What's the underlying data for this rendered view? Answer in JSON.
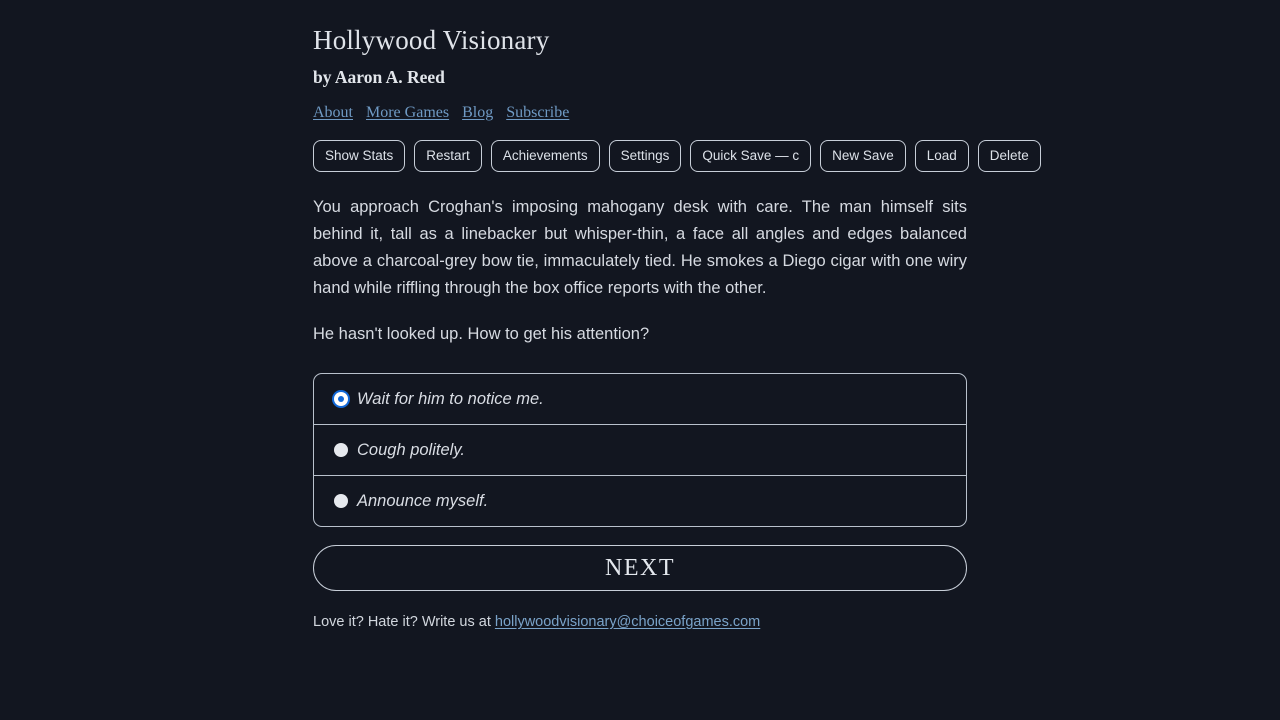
{
  "page": {
    "background_color": "#121620",
    "text_color": "#d6dae1",
    "link_color": "#6f9ac4",
    "accent_color": "#1168d8",
    "border_color": "#c7ced8"
  },
  "header": {
    "title": "Hollywood Visionary",
    "byline": "by Aaron A. Reed",
    "nav": [
      {
        "label": "About"
      },
      {
        "label": "More Games"
      },
      {
        "label": "Blog"
      },
      {
        "label": "Subscribe"
      }
    ]
  },
  "toolbar": {
    "buttons": [
      {
        "label": "Show Stats"
      },
      {
        "label": "Restart"
      },
      {
        "label": "Achievements"
      },
      {
        "label": "Settings"
      },
      {
        "label": "Quick Save — c"
      },
      {
        "label": "New Save"
      },
      {
        "label": "Load"
      },
      {
        "label": "Delete"
      }
    ]
  },
  "main": {
    "story": "You approach Croghan's imposing mahogany desk with care. The man himself sits behind it, tall as a linebacker but whisper-thin, a face all angles and edges balanced above a charcoal-grey bow tie, immaculately tied. He smokes a Diego cigar with one wiry hand while riffling through the box office reports with the other.",
    "question": "He hasn't looked up. How to get his attention?",
    "choices": [
      {
        "label": "Wait for him to notice me.",
        "selected": true
      },
      {
        "label": "Cough politely.",
        "selected": false
      },
      {
        "label": "Announce myself.",
        "selected": false
      }
    ],
    "next_label": "NEXT"
  },
  "footer": {
    "prompt": "Love it? Hate it? Write us at",
    "email": "hollywoodvisionary@choiceofgames.com"
  }
}
